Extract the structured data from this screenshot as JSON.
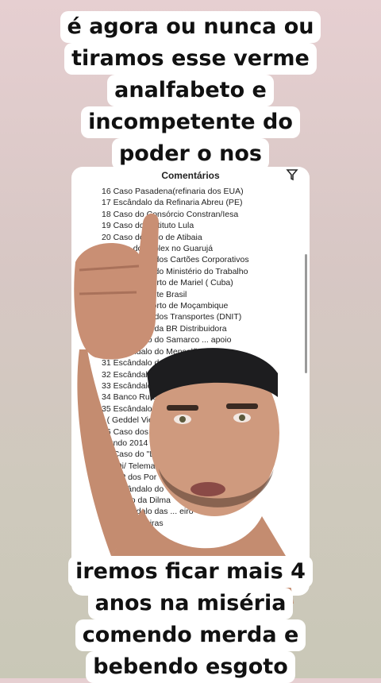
{
  "captions": {
    "top": [
      "é agora ou nunca ou",
      "tiramos esse verme",
      "analfabeto e",
      "incompetente do",
      "poder o nos"
    ],
    "bottom": [
      "iremos ficar mais 4",
      "anos na miséria",
      "comendo merda e",
      "bebendo esgoto"
    ]
  },
  "comments_sheet": {
    "title": "Comentários",
    "items": [
      "16 Caso Pasadena(refinaria dos EUA)",
      "17 Escândalo da Refinaria Abreu (PE)",
      "18 Caso do Consórcio Constran/Iesa",
      "19 Caso do Instituto Lula",
      "20 Caso do Sítio de Atibaia",
      "21 caso do Triplex no Guarujá",
      "22 Escândalo dos Cartões Corporativos",
      "23 Escândalo do Ministério do Trabalho",
      "24 Caso do Porto de Mariel ( Cuba)",
      "25 Caso da Sete Brasil",
      "26 Caso do Porto de Moçambique",
      "27 Escândalo dos Transportes (DNIT)",
      "28 Escândalo da BR Distribuidora",
      "29 Escândalo do Samarco ... apoio",
      "30 Escândalo do Mensalão",
      "31 Escândalo da",
      "32 Escândalo d",
      "33 Escândalo do Banco Rural",
      "34 Banco Rural",
      "35 Escândalo",
      "\" ( Geddel Vie",
      "36 Caso dos Mundo 2014",
      "Mundo 2014",
      "37 Caso do \"L",
      "e a Oi/ Telemar",
      "38 MP dos Por",
      "39 Escândalo do",
      "reeleição da Dilma",
      "40 Escândalo das ... eiro",
      "das empreiteiras"
    ]
  }
}
